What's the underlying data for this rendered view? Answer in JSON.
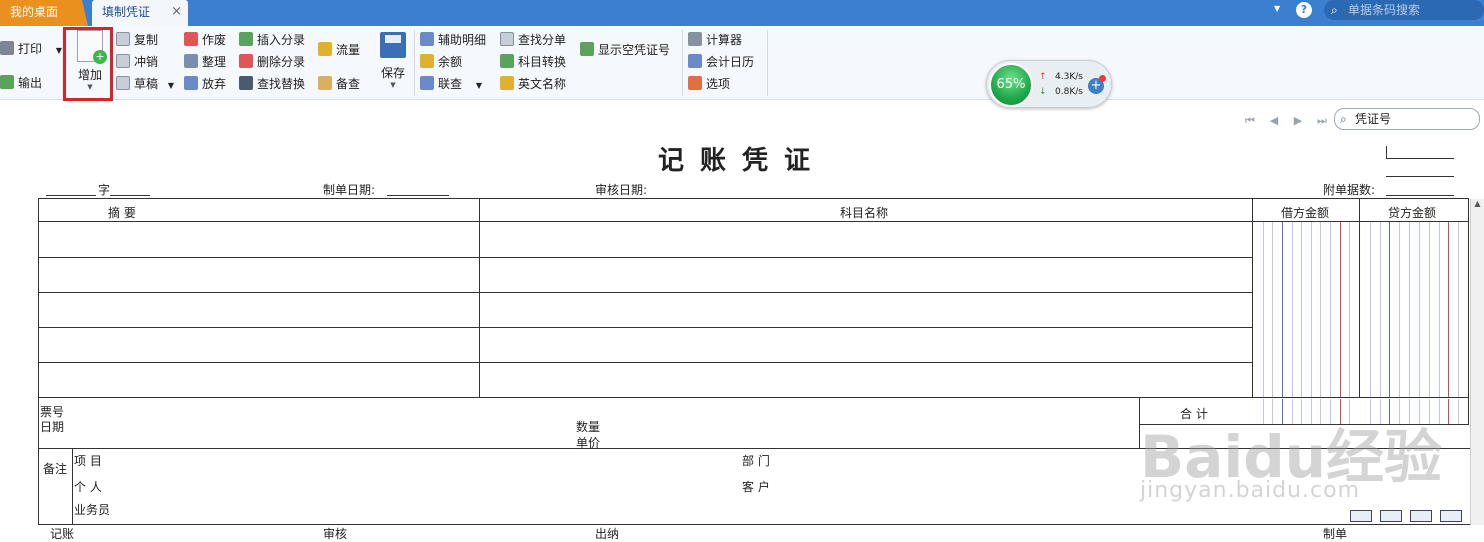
{
  "tabs": {
    "home": "我的桌面",
    "active": "填制凭证",
    "close": "×"
  },
  "header_search": {
    "placeholder": "单据条码搜索"
  },
  "help": "?",
  "toolbar": {
    "print": "打印",
    "export": "输出",
    "add": "增加",
    "copy": "复制",
    "reverse": "冲销",
    "draft": "草稿",
    "void": "作废",
    "arrange": "整理",
    "discard": "放弃",
    "insert_entry": "插入分录",
    "delete_entry": "删除分录",
    "find_replace": "查找替换",
    "flow": "流量",
    "backup_check": "备查",
    "save": "保存",
    "aux_detail": "辅助明细",
    "balance": "余额",
    "linked_query": "联查",
    "find_entry": "查找分单",
    "subject_convert": "科目转换",
    "english_name": "英文名称",
    "show_empty_no": "显示空凭证号",
    "calculator": "计算器",
    "calendar": "会计日历",
    "options": "选项"
  },
  "widget": {
    "percent": "65%",
    "up": "4.3K/s",
    "down": "0.8K/s",
    "plus": "+"
  },
  "voucher_search": {
    "placeholder": "凭证号"
  },
  "voucher": {
    "title": "记账凭证",
    "word_label": "字",
    "create_date_label": "制单日期:",
    "audit_date_label": "审核日期:",
    "attachments_label": "附单据数:",
    "col_summary": "摘 要",
    "col_subject": "科目名称",
    "col_debit": "借方金额",
    "col_credit": "贷方金额",
    "ticket_no": "票号",
    "date": "日期",
    "quantity": "数量",
    "unit_price": "单价",
    "total": "合 计",
    "remark": "备注",
    "project": "项 目",
    "department": "部 门",
    "person": "个 人",
    "customer": "客 户",
    "salesperson": "业务员",
    "bookkeeper": "记账",
    "auditor": "审核",
    "cashier": "出纳",
    "preparer": "制单"
  },
  "watermark": {
    "brand": "Baidu经验",
    "url": "jingyan.baidu.com"
  },
  "colors": {
    "titlebar": "#3a7fd0",
    "home_tab": "#e9901e",
    "highlight": "#d8232a",
    "gauge": "#1fa84a"
  }
}
